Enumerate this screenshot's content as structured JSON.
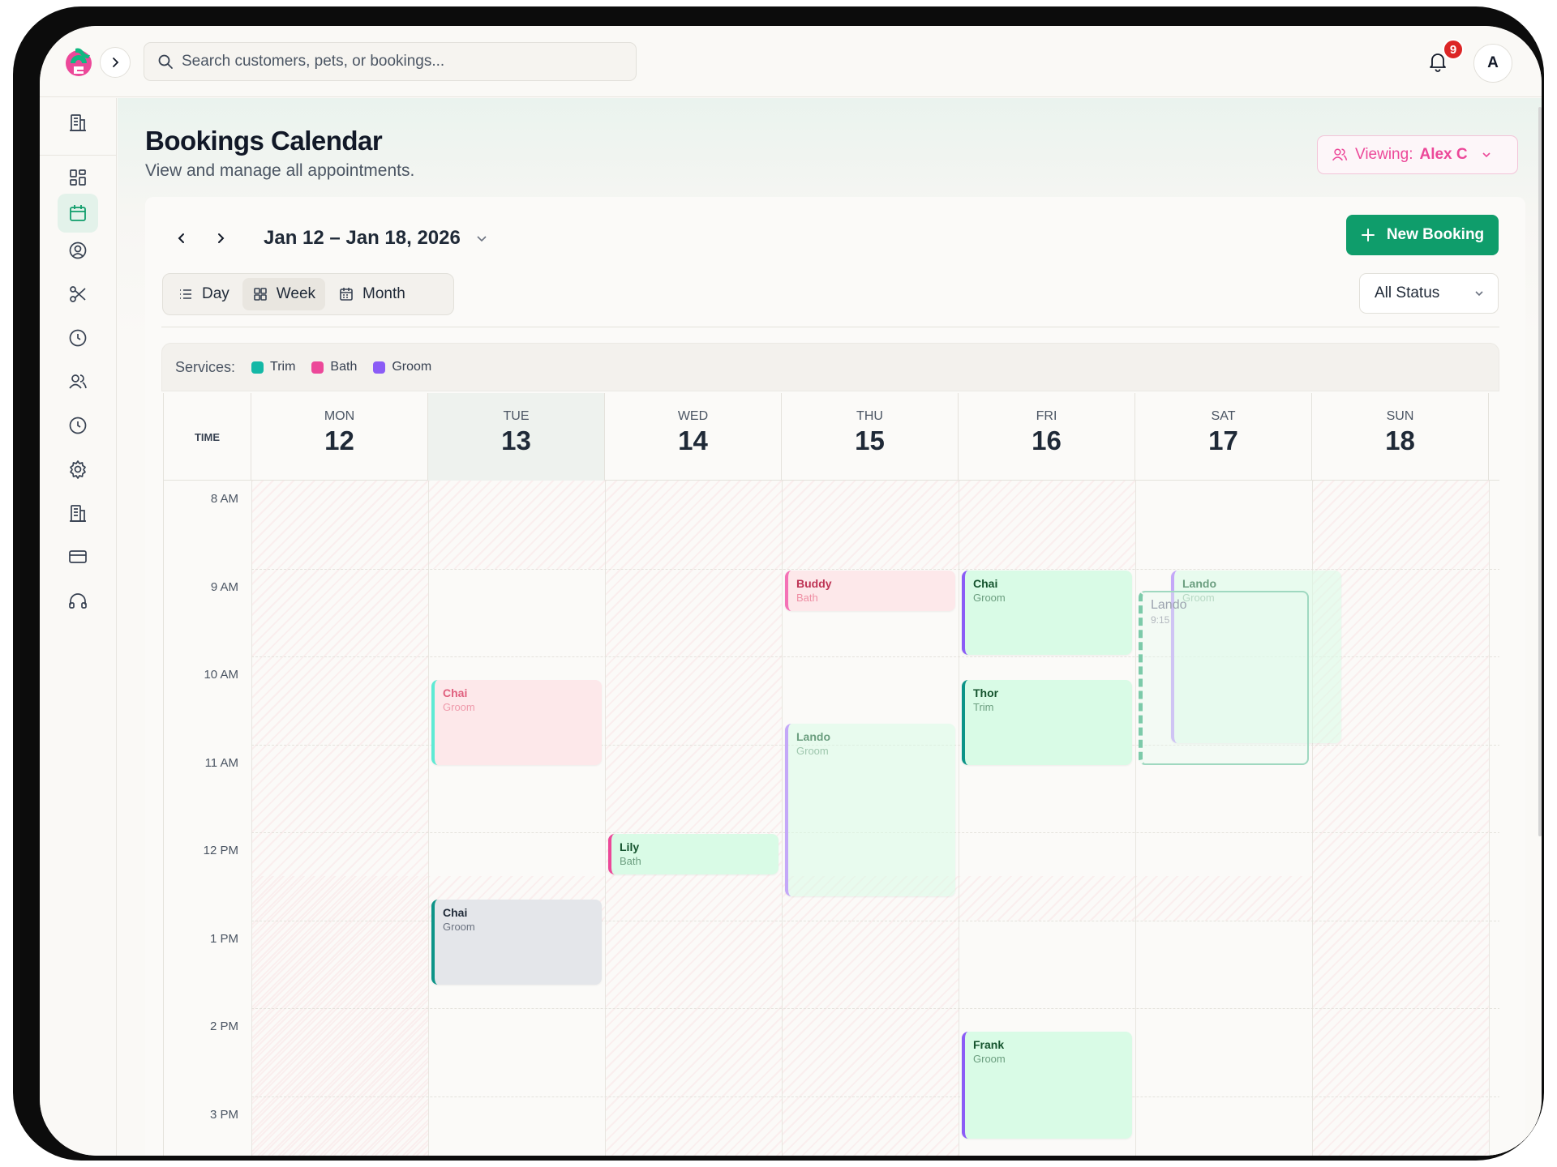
{
  "search": {
    "placeholder": "Search customers, pets, or bookings..."
  },
  "notifications": {
    "count": "9"
  },
  "user": {
    "initial": "A"
  },
  "page": {
    "title": "Bookings Calendar",
    "subtitle": "View and manage all appointments."
  },
  "viewing": {
    "label": "Viewing:",
    "name": "Alex C"
  },
  "calendar": {
    "range": "Jan 12 – Jan 18, 2026",
    "new_booking": "New Booking",
    "views": {
      "day": "Day",
      "week": "Week",
      "month": "Month"
    },
    "status_filter": "All Status",
    "services_label": "Services:",
    "services": [
      {
        "name": "Trim",
        "color": "#14b8a6"
      },
      {
        "name": "Bath",
        "color": "#ec4899"
      },
      {
        "name": "Groom",
        "color": "#8b5cf6"
      }
    ],
    "time_header": "TIME",
    "days": [
      {
        "name": "MON",
        "num": "12"
      },
      {
        "name": "TUE",
        "num": "13"
      },
      {
        "name": "WED",
        "num": "14"
      },
      {
        "name": "THU",
        "num": "15"
      },
      {
        "name": "FRI",
        "num": "16"
      },
      {
        "name": "SAT",
        "num": "17"
      },
      {
        "name": "SUN",
        "num": "18"
      }
    ],
    "hours": [
      "8 AM",
      "9 AM",
      "10 AM",
      "11 AM",
      "12 PM",
      "1 PM",
      "2 PM",
      "3 PM"
    ],
    "events": [
      {
        "pet": "Buddy",
        "service": "Bath",
        "day": 3,
        "start": 9.0,
        "end": 9.5,
        "style": "pink"
      },
      {
        "pet": "Chai",
        "service": "Groom",
        "day": 4,
        "start": 9.0,
        "end": 10.0,
        "style": "green-purple"
      },
      {
        "pet": "Lando",
        "service": "Groom",
        "day": 5,
        "start": 9.0,
        "end": 11.0,
        "style": "green-purple-faded"
      },
      {
        "pet": "Chai",
        "service": "Groom",
        "day": 1,
        "start": 10.25,
        "end": 11.25,
        "style": "pink-teal"
      },
      {
        "pet": "Thor",
        "service": "Trim",
        "day": 4,
        "start": 10.25,
        "end": 11.25,
        "style": "green-teal"
      },
      {
        "pet": "Lando",
        "service": "Groom",
        "day": 3,
        "start": 10.75,
        "end": 12.75,
        "style": "green-purple-faded"
      },
      {
        "pet": "Lily",
        "service": "Bath",
        "day": 2,
        "start": 12.0,
        "end": 12.5,
        "style": "green-pink"
      },
      {
        "pet": "Chai",
        "service": "Groom",
        "day": 1,
        "start": 12.75,
        "end": 13.75,
        "style": "gray-teal"
      },
      {
        "pet": "Frank",
        "service": "Groom",
        "day": 4,
        "start": 14.25,
        "end": 15.5,
        "style": "green-purple"
      }
    ],
    "drag_ghost": {
      "pet": "Lando",
      "time": "9:15",
      "day": 5,
      "start": 9.25,
      "end": 11.25
    }
  }
}
